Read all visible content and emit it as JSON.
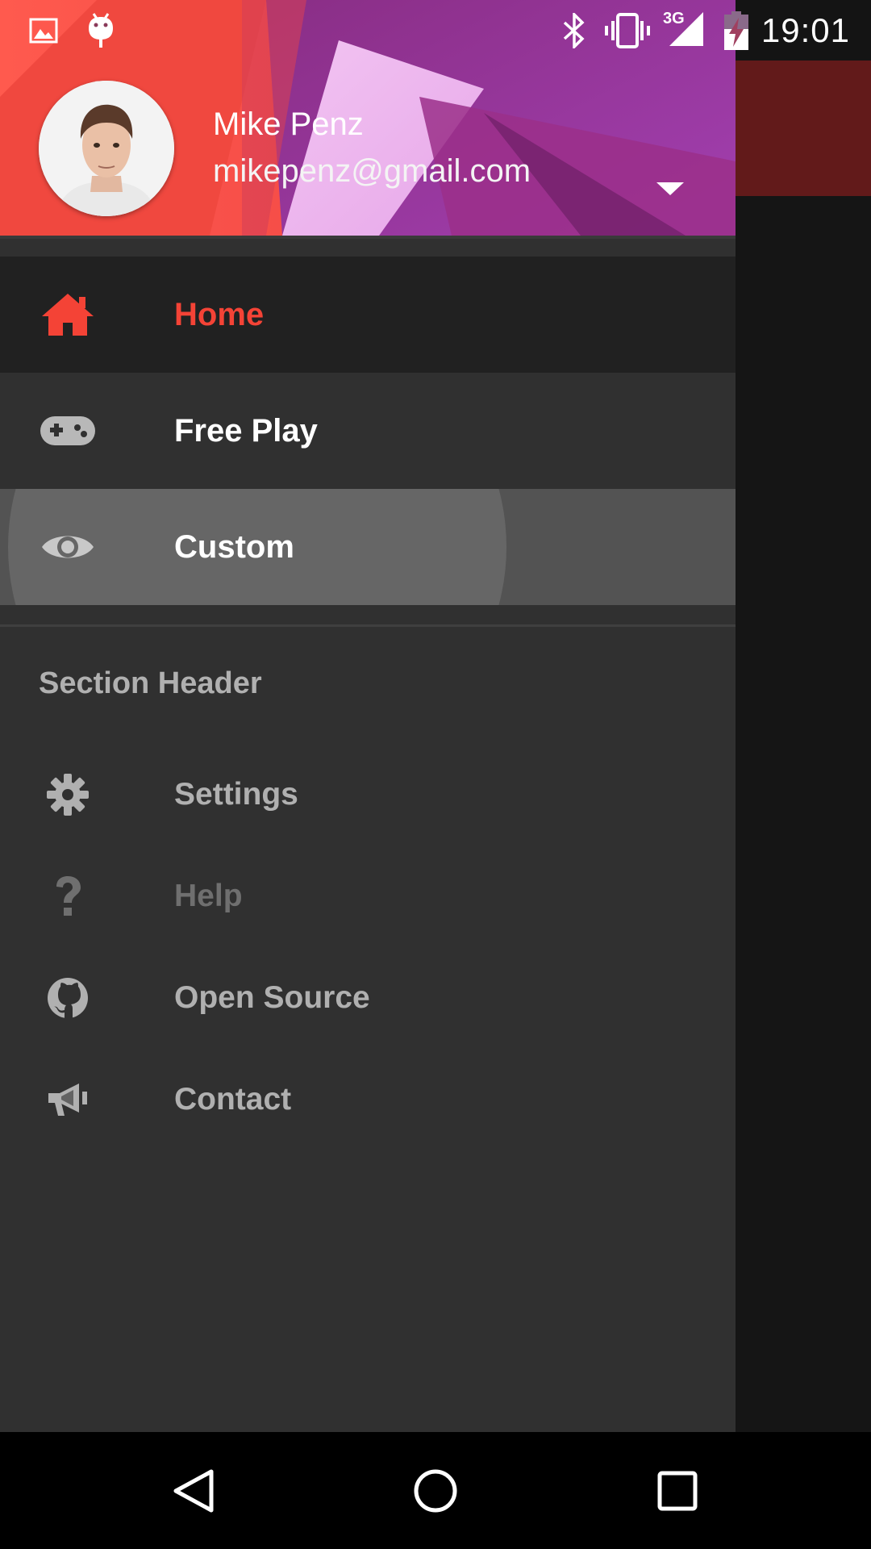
{
  "status_bar": {
    "time": "19:01",
    "network": "3G",
    "icons": [
      "image-icon",
      "android-icon",
      "bluetooth-icon",
      "vibrate-icon",
      "signal-icon",
      "battery-charging-icon"
    ]
  },
  "header": {
    "name": "Mike Penz",
    "email": "mikepenz@gmail.com",
    "dropdown_icon": "arrow-drop-down-icon"
  },
  "primary_items": [
    {
      "label": "Home",
      "icon": "home-icon",
      "selected": true
    },
    {
      "label": "Free Play",
      "icon": "gamepad-icon"
    },
    {
      "label": "Custom",
      "icon": "eye-icon",
      "pressed": true
    }
  ],
  "section_header": "Section Header",
  "secondary_items": [
    {
      "label": "Settings",
      "icon": "gear-icon"
    },
    {
      "label": "Help",
      "icon": "question-icon",
      "disabled": true
    },
    {
      "label": "Open Source",
      "icon": "github-icon"
    },
    {
      "label": "Contact",
      "icon": "megaphone-icon"
    }
  ],
  "colors": {
    "accent": "#f44336",
    "drawer_bg": "#303030",
    "selected_bg": "#212121",
    "pressed_bg": "#535353",
    "primary_text": "#ffffff",
    "secondary_text": "#b0b0b0",
    "disabled_text": "#6f6f6f"
  },
  "nav_bar": {
    "buttons": [
      "back-icon",
      "home-circle-icon",
      "recents-icon"
    ]
  }
}
